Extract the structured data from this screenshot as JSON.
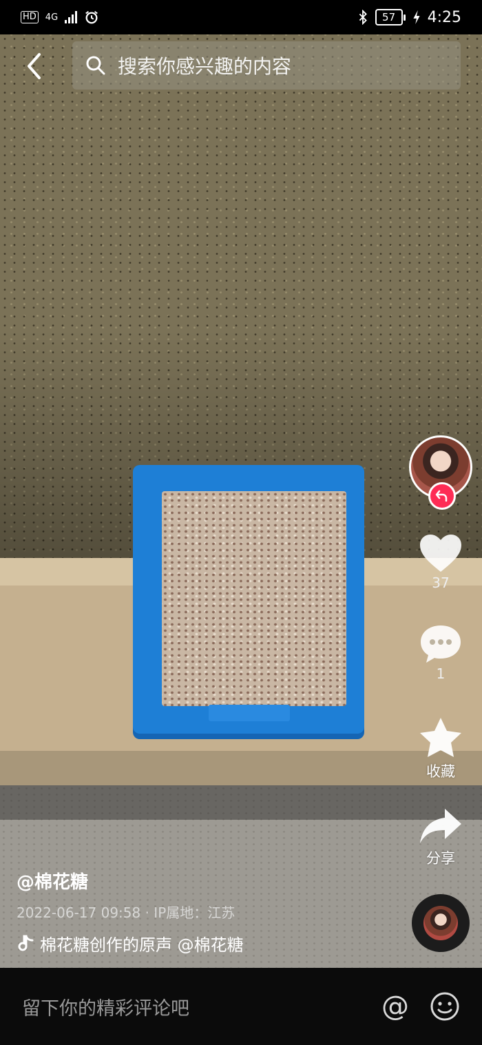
{
  "status_bar": {
    "hd": "HD",
    "network": "4G",
    "battery": "57",
    "time": "4:25"
  },
  "header": {
    "search_placeholder": "搜索你感兴趣的内容"
  },
  "side_rail": {
    "like_count": "37",
    "comment_count": "1",
    "favorite_label": "收藏",
    "share_label": "分享"
  },
  "video_info": {
    "author": "@棉花糖",
    "meta": "2022-06-17 09:58 · IP属地：江苏",
    "music": "棉花糖创作的原声    @棉花糖"
  },
  "comment_bar": {
    "placeholder": "留下你的精彩评论吧",
    "at_symbol": "@"
  },
  "icons": [
    "back-icon",
    "search-icon",
    "heart-icon",
    "comment-icon",
    "star-icon",
    "share-icon",
    "music-note-icon",
    "emoji-icon",
    "bluetooth-icon",
    "alarm-icon",
    "charging-icon"
  ],
  "colors": {
    "follow_accent": "#fe2c55",
    "box_blue": "#1e7fd6"
  }
}
